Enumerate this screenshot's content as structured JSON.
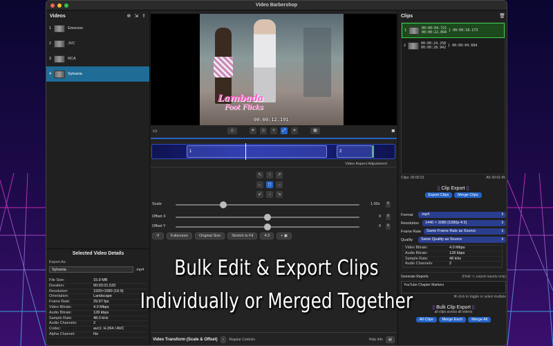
{
  "window": {
    "title": "Video Barbershop"
  },
  "videos": {
    "title": "Videos",
    "items": [
      {
        "num": "1",
        "name": "Emerson"
      },
      {
        "num": "2",
        "name": "JVC"
      },
      {
        "num": "3",
        "name": "RCA"
      },
      {
        "num": "4",
        "name": "Sylvania"
      }
    ]
  },
  "details": {
    "title": "Selected Video Details",
    "export_as_label": "Export As:",
    "export_as_value": "Sylvania",
    "ext": ".mp4",
    "rows": [
      {
        "k": "File Size:",
        "v": "15.9 MB"
      },
      {
        "k": "Duration:",
        "v": "00:00:31.533"
      },
      {
        "k": "Resolution:",
        "v": "1920×1080 (16:9)"
      },
      {
        "k": "Orientation:",
        "v": "Landscape"
      },
      {
        "k": "Frame Rate:",
        "v": "29.97 fps"
      },
      {
        "k": "Video Bitrate:",
        "v": "4.0 Mbps"
      },
      {
        "k": "Audio Bitrate:",
        "v": "128 kbps"
      },
      {
        "k": "Sample Rate:",
        "v": "48.0 kHz"
      },
      {
        "k": "Audio Channels:",
        "v": "2"
      },
      {
        "k": "Codec:",
        "v": "avc1: H.264 / AVC"
      },
      {
        "k": "Alpha Channel:",
        "v": "No"
      }
    ]
  },
  "player": {
    "overlay_line1": "Lambada",
    "overlay_line2": "Foot Flicks",
    "timecode": "00:00:12.191"
  },
  "timeline": {
    "segment1": "1",
    "segment2": "2"
  },
  "aspect": {
    "label": "Video Aspect Adjustment"
  },
  "transform": {
    "scale_label": "Scale",
    "scale_value": "1.00x",
    "offx_label": "Offset X",
    "offx_value": "0",
    "offy_label": "Offset Y",
    "offy_value": "0",
    "buttons": [
      "Fullscreen",
      "Original Size",
      "Stretch to Fit",
      "4:3"
    ],
    "footer_title": "Video Transform (Scale & Offset)",
    "regular_controls": "Regular Controls",
    "help": "Help Info"
  },
  "clips": {
    "title": "Clips",
    "items": [
      {
        "num": "1",
        "in": "00:00:04.721",
        "out": "00:00:22.894",
        "dur": "00:00:18.173"
      },
      {
        "num": "2",
        "in": "00:00:24.258",
        "out": "00:00:28.942",
        "dur": "00:00:04.684"
      }
    ],
    "summary_clips": "Clips: 00:00:23",
    "summary_all": "All: 00:01:45"
  },
  "clip_export": {
    "title": "Clip Export",
    "export_btn": "Export Clips",
    "merge_btn": "Merge Clips",
    "format_label": "Format",
    "format_value": ".mp4",
    "res_label": "Resolution",
    "res_value": "1440 × 1080 (1080p 4:3)",
    "fr_label": "Frame Rate",
    "fr_value": "Same Frame Rate as Source",
    "q_label": "Quality",
    "q_value": "Same Quality as Source",
    "rows": [
      {
        "k": "Video Bitrate:",
        "v": "4.0 Mbps"
      },
      {
        "k": "Audio Bitrate:",
        "v": "128 kbps"
      },
      {
        "k": "Sample Rate:",
        "v": "48 kHz"
      },
      {
        "k": "Audio Channels:",
        "v": "2"
      }
    ],
    "reports_label": "Generate Reports",
    "reports_hint": "(Hold ⌥ export reports only)",
    "reports_item": "YouTube Chapter Markers",
    "toggle_hint": "⌘-click to toggle or select multiple"
  },
  "bulk": {
    "title": "Bulk Clip Export",
    "subtitle": "all clips across all videos",
    "all_btn": "All Clips",
    "each_btn": "Merge Each",
    "all_merge_btn": "Merge All"
  },
  "caption": {
    "line1": "Bulk Edit & Export Clips",
    "line2": "Individually or Merged Together"
  },
  "colors": {
    "accent": "#2463c7",
    "selection": "#1f6c97",
    "clip_selected": "#1d4a1d"
  }
}
